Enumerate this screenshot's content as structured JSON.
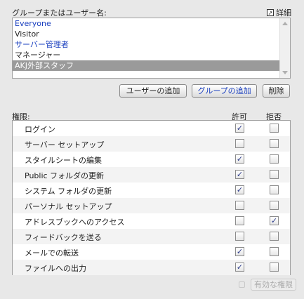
{
  "header": {
    "title": "グループまたはユーザー名:",
    "detail_label": "詳細"
  },
  "principals": [
    {
      "label": "Everyone",
      "type": "group",
      "selected": false
    },
    {
      "label": "Visitor",
      "type": "user",
      "selected": false
    },
    {
      "label": "サーバー管理者",
      "type": "group",
      "selected": false
    },
    {
      "label": "マネージャー",
      "type": "user",
      "selected": false
    },
    {
      "label": "AKJ外部スタッフ",
      "type": "group",
      "selected": true
    }
  ],
  "buttons": {
    "add_user": "ユーザーの追加",
    "add_group": "グループの追加",
    "delete": "削除",
    "effective": "有効な権限"
  },
  "permissions": {
    "label": "権限:",
    "allow_header": "許可",
    "deny_header": "拒否",
    "check_mark": "✓",
    "items": [
      {
        "label": "ログイン",
        "allow": true,
        "deny": false
      },
      {
        "label": "サーバー セットアップ",
        "allow": false,
        "deny": false
      },
      {
        "label": "スタイルシートの編集",
        "allow": true,
        "deny": false
      },
      {
        "label": "Public フォルダの更新",
        "allow": true,
        "deny": false
      },
      {
        "label": "システム フォルダの更新",
        "allow": true,
        "deny": false
      },
      {
        "label": "パーソナル セットアップ",
        "allow": false,
        "deny": false
      },
      {
        "label": "アドレスブックへのアクセス",
        "allow": false,
        "deny": true
      },
      {
        "label": "フィードバックを送る",
        "allow": false,
        "deny": false
      },
      {
        "label": "メールでの転送",
        "allow": true,
        "deny": false
      },
      {
        "label": "ファイルへの出力",
        "allow": true,
        "deny": false
      }
    ]
  },
  "colors": {
    "group_text": "#1a3fbf",
    "selected_row": "#9a9a9a",
    "alt_row": "#f3f3f3"
  }
}
